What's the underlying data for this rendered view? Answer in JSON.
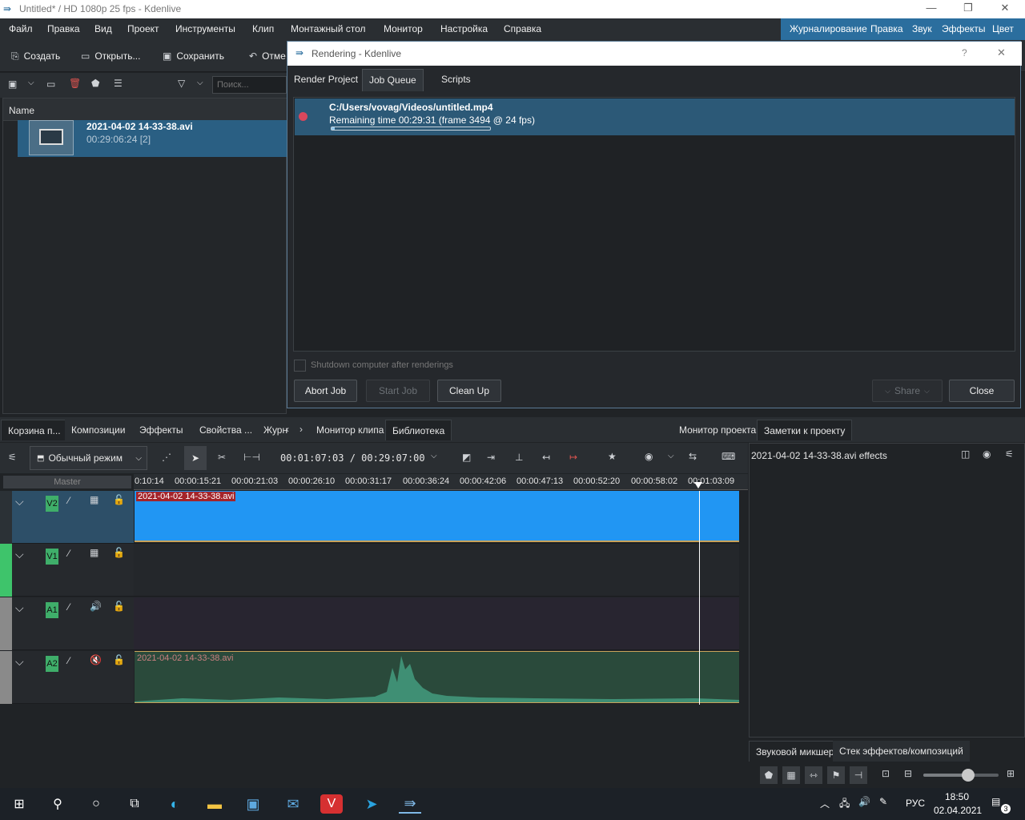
{
  "window": {
    "title": "Untitled* / HD 1080p 25 fps - Kdenlive"
  },
  "menu": {
    "items": [
      "Файл",
      "Правка",
      "Вид",
      "Проект",
      "Инструменты",
      "Клип",
      "Монтажный стол",
      "Монитор",
      "Настройка",
      "Справка"
    ]
  },
  "workspaces": {
    "items": [
      "Журналирование",
      "Правка",
      "Звук",
      "Эффекты",
      "Цвет"
    ]
  },
  "toolbar": {
    "create": "Создать",
    "open": "Открыть...",
    "save": "Сохранить",
    "undo": "Отме"
  },
  "bin": {
    "search_placeholder": "Поиск...",
    "column_name": "Name",
    "clip": {
      "name": "2021-04-02 14-33-38.avi",
      "duration": "00:29:06:24 [2]"
    }
  },
  "dialog": {
    "title": "Rendering - Kdenlive",
    "tabs": [
      "Render Project",
      "Job Queue",
      "Scripts"
    ],
    "job": {
      "path": "C:/Users/vovag/Videos/untitled.mp4",
      "status": "Remaining time 00:29:31 (frame 3494 @ 24 fps)",
      "progress": 0.02
    },
    "shutdown_label": "Shutdown computer after renderings",
    "buttons": {
      "abort": "Abort Job",
      "start": "Start Job",
      "cleanup": "Clean Up",
      "share": "Share",
      "close": "Close"
    }
  },
  "dock_tabs": {
    "left": [
      "Корзина п...",
      "Композиции",
      "Эффекты",
      "Свойства ...",
      "Журн"
    ],
    "monitor": [
      "Монитор клипа",
      "Библиотека"
    ],
    "right": [
      "Монитор проекта",
      "Заметки к проекту"
    ]
  },
  "timeline": {
    "mode": "Обычный режим",
    "timecode": "00:01:07:03 / 00:29:07:00",
    "master_label": "Master",
    "ruler": [
      "0:10:14",
      "00:00:15:21",
      "00:00:21:03",
      "00:00:26:10",
      "00:00:31:17",
      "00:00:36:24",
      "00:00:42:06",
      "00:00:47:13",
      "00:00:52:20",
      "00:00:58:02",
      "00:01:03:09"
    ],
    "tracks": [
      {
        "label": "V2",
        "clip": "2021-04-02 14-33-38.avi"
      },
      {
        "label": "V1",
        "clip": ""
      },
      {
        "label": "A1",
        "clip": ""
      },
      {
        "label": "A2",
        "clip": "2021-04-02 14-33-38.avi"
      }
    ]
  },
  "effects_panel": {
    "title": "2021-04-02 14-33-38.avi effects",
    "tabs": [
      "Звуковой микшер",
      "Стек эффектов/композиций"
    ]
  },
  "taskbar": {
    "lang": "РУС",
    "time": "18:50",
    "date": "02.04.2021",
    "notif_count": "3"
  }
}
